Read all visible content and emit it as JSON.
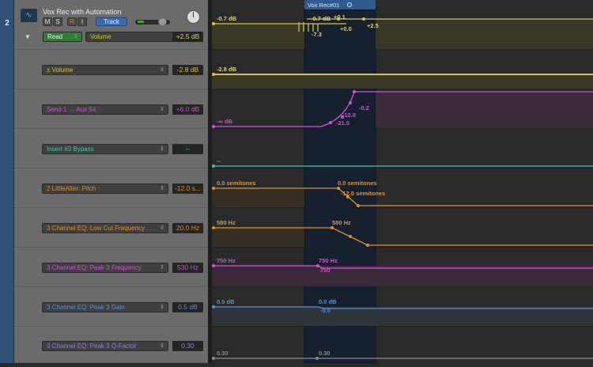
{
  "track": {
    "number": "2",
    "name": "Vox Rec with Automation",
    "mute": "M",
    "solo": "S",
    "record": "R",
    "input": "I",
    "track_button": "Track",
    "mode": "Read",
    "parameter": "Volume",
    "value": "+2.5 dB"
  },
  "lanes": [
    {
      "parameter": "± Volume",
      "value": "-2.8 dB",
      "color": "#d8c43a"
    },
    {
      "parameter": "Send 1 → Aux 54",
      "value": "+6.0 dB",
      "color": "#d24fd6"
    },
    {
      "parameter": "Insert #3 Bypass",
      "value": "--",
      "color": "#3fc8b8"
    },
    {
      "parameter": "2 LittleAlter: Pitch",
      "value": "-12.0 s...",
      "color": "#e0902e"
    },
    {
      "parameter": "3 Channel EQ: Low Cut Frequency",
      "value": "20.0 Hz",
      "color": "#e0902e"
    },
    {
      "parameter": "3 Channel EQ: Peak 3 Frequency",
      "value": "530 Hz",
      "color": "#d24fd6"
    },
    {
      "parameter": "3 Channel EQ: Peak 3 Gain",
      "value": "0.5 dB",
      "color": "#5b8fd4"
    },
    {
      "parameter": "3 Channel EQ: Peak 3 Q-Factor",
      "value": "0.30",
      "color": "#9a78d8"
    }
  ],
  "region": {
    "name": "Vox Rec#01"
  },
  "labels": {
    "vol_start": "-0.7 dB",
    "vol_r1": "-0.7 dB",
    "vol_r2": "+0.1",
    "vol_r3": "+0.0",
    "vol_r4": "+2.5",
    "vol_r5": "-7.3",
    "lane1_start": "-2.8 dB",
    "send_start": "-∞ dB",
    "send_a": "-0.2",
    "send_b": "-12.0",
    "send_c": "-21.0",
    "bypass_start": "--",
    "pitch_start": "0.0 semitones",
    "pitch_r1": "0.0 semitones",
    "pitch_r2": "-12.0 semitones",
    "lowcut_start": "580 Hz",
    "lowcut_r1": "580 Hz",
    "peakf_start": "750 Hz",
    "peakf_r1": "750 Hz",
    "peakf_r2": "750",
    "gain_start": "0.0 dB",
    "gain_r1": "0.0 dB",
    "gain_r2": "-0.5",
    "q_start": "0.30",
    "q_r1": "0.30"
  },
  "colors": {
    "volume": "#d8c43a",
    "send": "#d24fd6",
    "bypass": "#3fc8b8",
    "pitch": "#e0902e",
    "gain": "#5b8fd4",
    "q": "#8a8a8a",
    "region": "#2f5a8f",
    "mode_read": "#2e7d32",
    "track_button": "#3a6ab0"
  }
}
